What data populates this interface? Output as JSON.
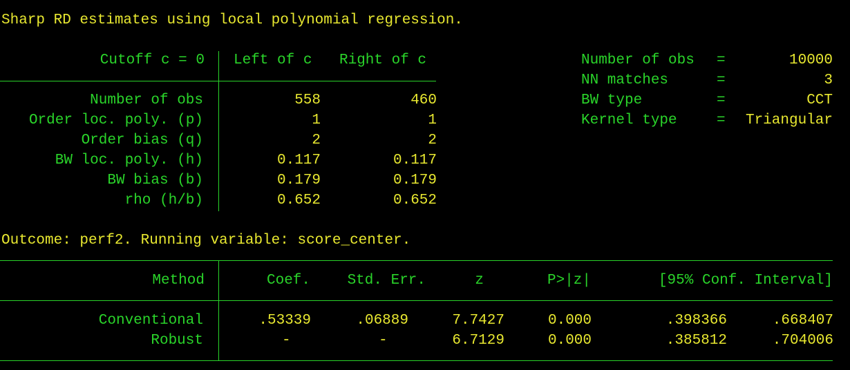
{
  "title": "Sharp RD estimates using local polynomial regression.",
  "left_table": {
    "header": {
      "cutoff": "Cutoff c = 0",
      "left": "Left of c",
      "right": "Right of c"
    },
    "rows": [
      {
        "label": "Number of obs",
        "left": "558",
        "right": "460"
      },
      {
        "label": "Order loc. poly. (p)",
        "left": "1",
        "right": "1"
      },
      {
        "label": "Order bias (q)",
        "left": "2",
        "right": "2"
      },
      {
        "label": "BW loc. poly. (h)",
        "left": "0.117",
        "right": "0.117"
      },
      {
        "label": "BW bias (b)",
        "left": "0.179",
        "right": "0.179"
      },
      {
        "label": "rho (h/b)",
        "left": "0.652",
        "right": "0.652"
      }
    ]
  },
  "right_stats": [
    {
      "label": "Number of obs",
      "eq": "=",
      "value": "10000"
    },
    {
      "label": "NN matches",
      "eq": "=",
      "value": "3"
    },
    {
      "label": "BW type",
      "eq": "=",
      "value": "CCT"
    },
    {
      "label": "Kernel type",
      "eq": "=",
      "value": "Triangular"
    }
  ],
  "outcome_line": "Outcome: perf2. Running variable: score_center.",
  "results_table": {
    "headers": {
      "method": "Method",
      "coef": "Coef.",
      "stderr": "Std. Err.",
      "z": "z",
      "p": "P>|z|",
      "ci": "[95% Conf. Interval]"
    },
    "rows": [
      {
        "method": "Conventional",
        "coef": ".53339",
        "stderr": ".06889",
        "z": "7.7427",
        "p": "0.000",
        "ci_low": ".398366",
        "ci_high": ".668407"
      },
      {
        "method": "Robust",
        "coef": "-",
        "stderr": "-",
        "z": "6.7129",
        "p": "0.000",
        "ci_low": ".385812",
        "ci_high": ".704006"
      }
    ]
  },
  "colors": {
    "background": "#000000",
    "text_yellow": "#e8e830",
    "text_green": "#2ad42a"
  }
}
